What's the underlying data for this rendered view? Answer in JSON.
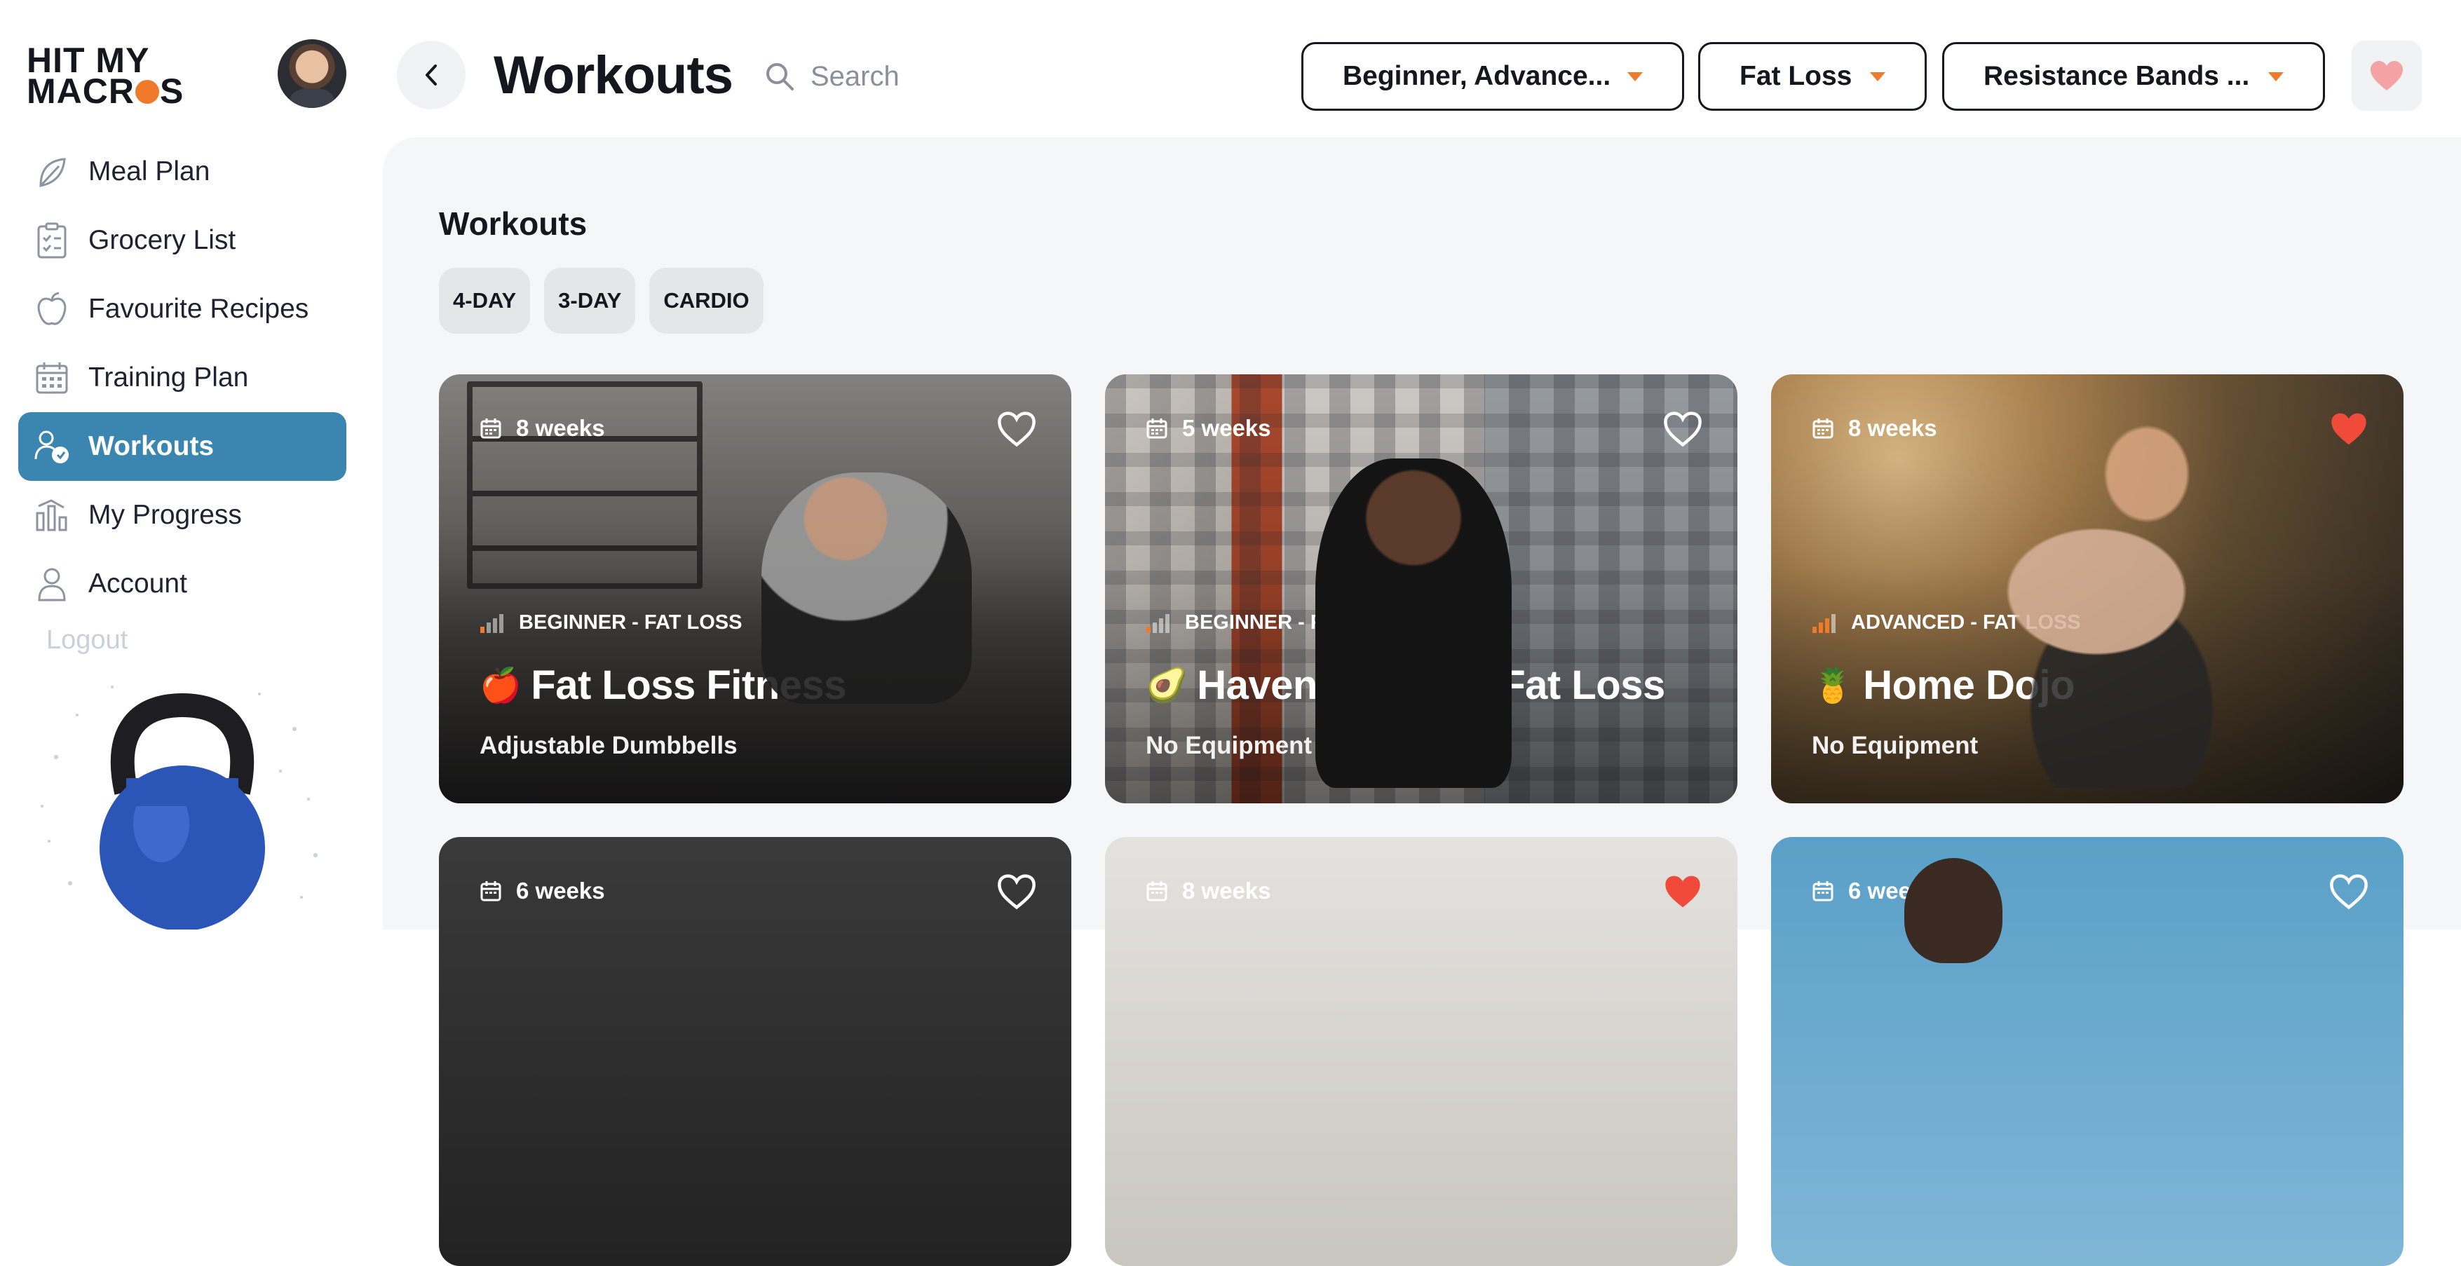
{
  "brand": {
    "logo_line1": "HIT MY",
    "logo_line2_a": "MACR",
    "logo_line2_b": "S"
  },
  "sidebar": {
    "items": [
      {
        "label": "Meal Plan",
        "icon": "leaf-icon"
      },
      {
        "label": "Grocery List",
        "icon": "checklist-icon"
      },
      {
        "label": "Favourite Recipes",
        "icon": "apple-icon"
      },
      {
        "label": "Training Plan",
        "icon": "calendar-icon"
      },
      {
        "label": "Workouts",
        "icon": "workout-user-icon",
        "active": true
      },
      {
        "label": "My Progress",
        "icon": "progress-chart-icon"
      },
      {
        "label": "Account",
        "icon": "person-icon"
      }
    ],
    "logout": "Logout"
  },
  "header": {
    "title": "Workouts",
    "search_placeholder": "Search",
    "filters": [
      {
        "label": "Beginner, Advance..."
      },
      {
        "label": "Fat Loss"
      },
      {
        "label": "Resistance Bands ..."
      }
    ]
  },
  "main": {
    "section_title": "Workouts",
    "chips": [
      "4-DAY",
      "3-DAY",
      "CARDIO"
    ],
    "cards": [
      {
        "weeks": "8 weeks",
        "level": "BEGINNER - FAT LOSS",
        "emoji": "🍎",
        "title": "Fat Loss Fitness",
        "equipment": "Adjustable Dumbbells",
        "favourited": false
      },
      {
        "weeks": "5 weeks",
        "level": "BEGINNER - FAT LOSS",
        "emoji": "🥑",
        "title": "Haven - Intro to Fat Loss",
        "equipment": "No Equipment",
        "favourited": false
      },
      {
        "weeks": "8 weeks",
        "level": "ADVANCED - FAT LOSS",
        "emoji": "🍍",
        "title": "Home Dojo",
        "equipment": "No Equipment",
        "favourited": true
      },
      {
        "weeks": "6 weeks",
        "favourited": false
      },
      {
        "weeks": "8 weeks",
        "favourited": true
      },
      {
        "weeks": "6 weeks",
        "favourited": false
      }
    ]
  },
  "colors": {
    "accent_orange": "#f07a2b",
    "active_blue": "#3b86b0",
    "heart_red": "#ef4a3a",
    "heart_pink": "#f3a3a3"
  }
}
